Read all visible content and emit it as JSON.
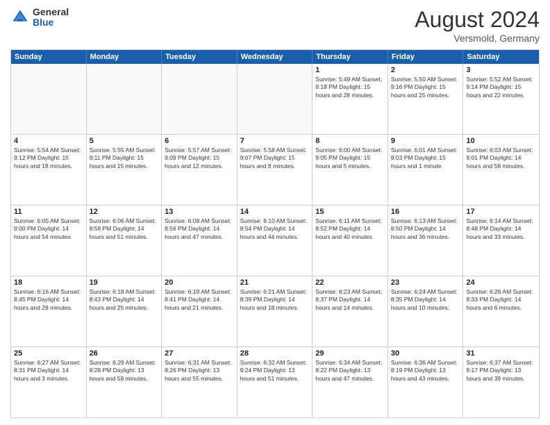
{
  "header": {
    "logo_general": "General",
    "logo_blue": "Blue",
    "month_title": "August 2024",
    "location": "Versmold, Germany"
  },
  "weekdays": [
    "Sunday",
    "Monday",
    "Tuesday",
    "Wednesday",
    "Thursday",
    "Friday",
    "Saturday"
  ],
  "rows": [
    [
      {
        "day": "",
        "text": ""
      },
      {
        "day": "",
        "text": ""
      },
      {
        "day": "",
        "text": ""
      },
      {
        "day": "",
        "text": ""
      },
      {
        "day": "1",
        "text": "Sunrise: 5:49 AM\nSunset: 9:18 PM\nDaylight: 15 hours\nand 28 minutes."
      },
      {
        "day": "2",
        "text": "Sunrise: 5:50 AM\nSunset: 9:16 PM\nDaylight: 15 hours\nand 25 minutes."
      },
      {
        "day": "3",
        "text": "Sunrise: 5:52 AM\nSunset: 9:14 PM\nDaylight: 15 hours\nand 22 minutes."
      }
    ],
    [
      {
        "day": "4",
        "text": "Sunrise: 5:54 AM\nSunset: 9:12 PM\nDaylight: 15 hours\nand 18 minutes."
      },
      {
        "day": "5",
        "text": "Sunrise: 5:55 AM\nSunset: 9:11 PM\nDaylight: 15 hours\nand 15 minutes."
      },
      {
        "day": "6",
        "text": "Sunrise: 5:57 AM\nSunset: 9:09 PM\nDaylight: 15 hours\nand 12 minutes."
      },
      {
        "day": "7",
        "text": "Sunrise: 5:58 AM\nSunset: 9:07 PM\nDaylight: 15 hours\nand 8 minutes."
      },
      {
        "day": "8",
        "text": "Sunrise: 6:00 AM\nSunset: 9:05 PM\nDaylight: 15 hours\nand 5 minutes."
      },
      {
        "day": "9",
        "text": "Sunrise: 6:01 AM\nSunset: 9:03 PM\nDaylight: 15 hours\nand 1 minute."
      },
      {
        "day": "10",
        "text": "Sunrise: 6:03 AM\nSunset: 9:01 PM\nDaylight: 14 hours\nand 58 minutes."
      }
    ],
    [
      {
        "day": "11",
        "text": "Sunrise: 6:05 AM\nSunset: 9:00 PM\nDaylight: 14 hours\nand 54 minutes."
      },
      {
        "day": "12",
        "text": "Sunrise: 6:06 AM\nSunset: 8:58 PM\nDaylight: 14 hours\nand 51 minutes."
      },
      {
        "day": "13",
        "text": "Sunrise: 6:08 AM\nSunset: 8:56 PM\nDaylight: 14 hours\nand 47 minutes."
      },
      {
        "day": "14",
        "text": "Sunrise: 6:10 AM\nSunset: 8:54 PM\nDaylight: 14 hours\nand 44 minutes."
      },
      {
        "day": "15",
        "text": "Sunrise: 6:11 AM\nSunset: 8:52 PM\nDaylight: 14 hours\nand 40 minutes."
      },
      {
        "day": "16",
        "text": "Sunrise: 6:13 AM\nSunset: 8:50 PM\nDaylight: 14 hours\nand 36 minutes."
      },
      {
        "day": "17",
        "text": "Sunrise: 6:14 AM\nSunset: 8:48 PM\nDaylight: 14 hours\nand 33 minutes."
      }
    ],
    [
      {
        "day": "18",
        "text": "Sunrise: 6:16 AM\nSunset: 8:45 PM\nDaylight: 14 hours\nand 29 minutes."
      },
      {
        "day": "19",
        "text": "Sunrise: 6:18 AM\nSunset: 8:43 PM\nDaylight: 14 hours\nand 25 minutes."
      },
      {
        "day": "20",
        "text": "Sunrise: 6:19 AM\nSunset: 8:41 PM\nDaylight: 14 hours\nand 21 minutes."
      },
      {
        "day": "21",
        "text": "Sunrise: 6:21 AM\nSunset: 8:39 PM\nDaylight: 14 hours\nand 18 minutes."
      },
      {
        "day": "22",
        "text": "Sunrise: 6:23 AM\nSunset: 8:37 PM\nDaylight: 14 hours\nand 14 minutes."
      },
      {
        "day": "23",
        "text": "Sunrise: 6:24 AM\nSunset: 8:35 PM\nDaylight: 14 hours\nand 10 minutes."
      },
      {
        "day": "24",
        "text": "Sunrise: 6:26 AM\nSunset: 8:33 PM\nDaylight: 14 hours\nand 6 minutes."
      }
    ],
    [
      {
        "day": "25",
        "text": "Sunrise: 6:27 AM\nSunset: 8:31 PM\nDaylight: 14 hours\nand 3 minutes."
      },
      {
        "day": "26",
        "text": "Sunrise: 6:29 AM\nSunset: 8:28 PM\nDaylight: 13 hours\nand 59 minutes."
      },
      {
        "day": "27",
        "text": "Sunrise: 6:31 AM\nSunset: 8:26 PM\nDaylight: 13 hours\nand 55 minutes."
      },
      {
        "day": "28",
        "text": "Sunrise: 6:32 AM\nSunset: 8:24 PM\nDaylight: 13 hours\nand 51 minutes."
      },
      {
        "day": "29",
        "text": "Sunrise: 6:34 AM\nSunset: 8:22 PM\nDaylight: 13 hours\nand 47 minutes."
      },
      {
        "day": "30",
        "text": "Sunrise: 6:36 AM\nSunset: 8:19 PM\nDaylight: 13 hours\nand 43 minutes."
      },
      {
        "day": "31",
        "text": "Sunrise: 6:37 AM\nSunset: 8:17 PM\nDaylight: 13 hours\nand 39 minutes."
      }
    ]
  ]
}
